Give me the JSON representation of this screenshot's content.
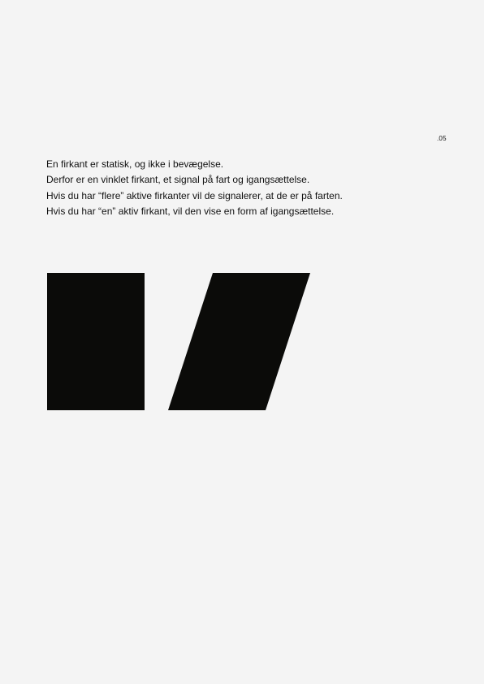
{
  "page": {
    "number": ".05"
  },
  "text": {
    "lines": [
      "En firkant er statisk, og ikke i bevægelse.",
      "Derfor er en vinklet firkant, et signal på fart og igangsættelse.",
      "Hvis du har “flere” aktive firkanter vil de signalerer, at de er på farten.",
      "Hvis du har “en” aktiv firkant, vil den vise en form af igangsættelse."
    ]
  },
  "colors": {
    "background": "#f4f4f4",
    "shape_fill": "#0b0b09",
    "text": "#111111"
  }
}
